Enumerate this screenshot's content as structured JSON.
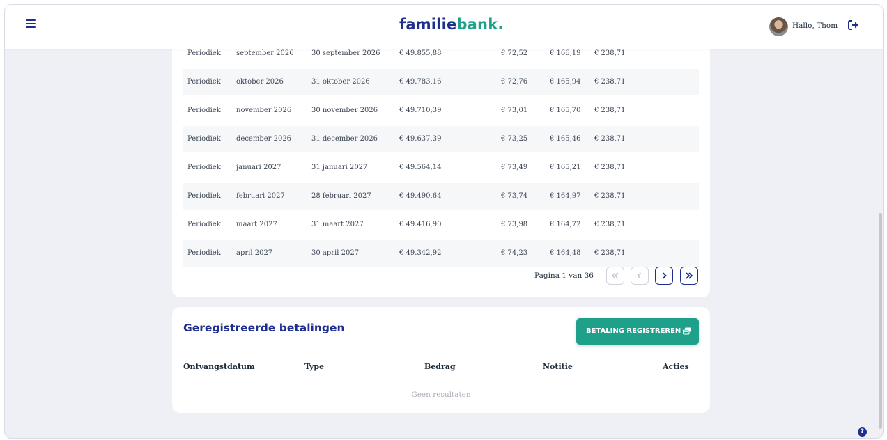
{
  "header": {
    "logo_part1": "familie",
    "logo_part2": "bank",
    "logo_dot": ".",
    "greeting": "Hallo, Thom"
  },
  "schedule": {
    "rows": [
      [
        "Periodiek",
        "september 2026",
        "30 september 2026",
        "€ 49.855,88",
        "€ 72,52",
        "€ 166,19",
        "€ 238,71"
      ],
      [
        "Periodiek",
        "oktober 2026",
        "31 oktober 2026",
        "€ 49.783,16",
        "€ 72,76",
        "€ 165,94",
        "€ 238,71"
      ],
      [
        "Periodiek",
        "november 2026",
        "30 november 2026",
        "€ 49.710,39",
        "€ 73,01",
        "€ 165,70",
        "€ 238,71"
      ],
      [
        "Periodiek",
        "december 2026",
        "31 december 2026",
        "€ 49.637,39",
        "€ 73,25",
        "€ 165,46",
        "€ 238,71"
      ],
      [
        "Periodiek",
        "januari 2027",
        "31 januari 2027",
        "€ 49.564,14",
        "€ 73,49",
        "€ 165,21",
        "€ 238,71"
      ],
      [
        "Periodiek",
        "februari 2027",
        "28 februari 2027",
        "€ 49.490,64",
        "€ 73,74",
        "€ 164,97",
        "€ 238,71"
      ],
      [
        "Periodiek",
        "maart 2027",
        "31 maart 2027",
        "€ 49.416,90",
        "€ 73,98",
        "€ 164,72",
        "€ 238,71"
      ],
      [
        "Periodiek",
        "april 2027",
        "30 april 2027",
        "€ 49.342,92",
        "€ 74,23",
        "€ 164,48",
        "€ 238,71"
      ]
    ],
    "pagination": {
      "info": "Pagina 1 van 36",
      "current_page": 1,
      "total_pages": 36
    }
  },
  "payments": {
    "title": "Geregistreerde betalingen",
    "register_button": "BETALING REGISTREREN",
    "columns": [
      "Ontvangstdatum",
      "Type",
      "Bedrag",
      "Notitie",
      "Acties"
    ],
    "empty_text": "Geen resultaten"
  },
  "help_label": "?",
  "colors": {
    "brand_blue": "#1e2f8f",
    "brand_green": "#1fa08b",
    "background": "#eef0f5"
  },
  "icons": [
    "menu-icon",
    "avatar",
    "logout-icon",
    "first-page-icon",
    "previous-page-icon",
    "next-page-icon",
    "last-page-icon",
    "payment-icon",
    "help-icon"
  ]
}
